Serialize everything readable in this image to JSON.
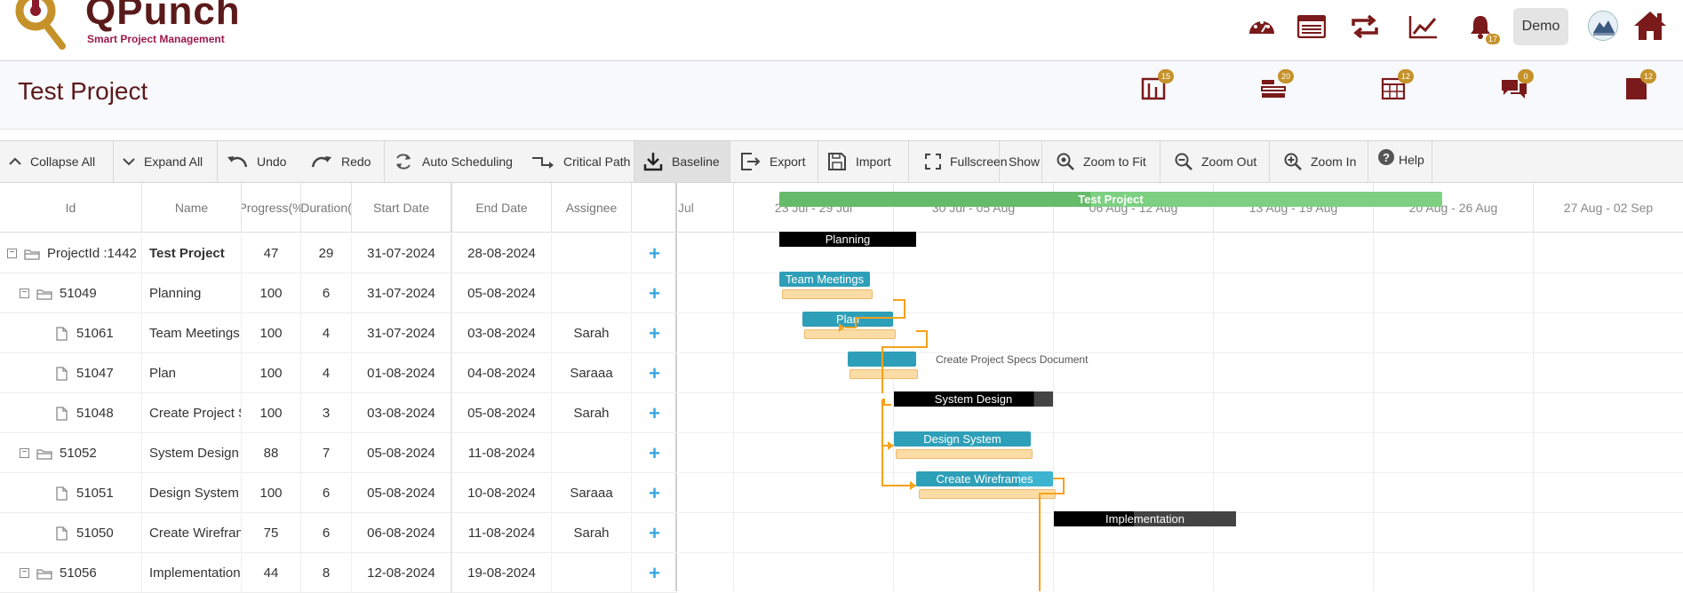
{
  "header": {
    "logo_title": "QPunch",
    "logo_sub": "Smart Project Management",
    "notifications_count": "17",
    "user_button": "Demo",
    "icons": [
      "dashboard-icon",
      "list-icon",
      "sync-icon",
      "chart-line-icon",
      "bell-icon",
      "avatar",
      "home-icon"
    ]
  },
  "project": {
    "title": "Test Project",
    "badges": [
      {
        "name": "tasks",
        "count": "15"
      },
      {
        "name": "backlog",
        "count": "20"
      },
      {
        "name": "calendar",
        "count": "12"
      },
      {
        "name": "chat",
        "count": "0"
      },
      {
        "name": "documents",
        "count": "12"
      }
    ]
  },
  "toolbar": {
    "collapse_all": "Collapse All",
    "expand_all": "Expand All",
    "undo": "Undo",
    "redo": "Redo",
    "auto_scheduling": "Auto Scheduling",
    "critical_path": "Critical Path",
    "baseline": "Baseline",
    "export": "Export",
    "import": "Import",
    "fullscreen": "Fullscreen",
    "show": "Show",
    "zoom_fit": "Zoom to Fit",
    "zoom_out": "Zoom Out",
    "zoom_in": "Zoom In",
    "help": "Help"
  },
  "grid": {
    "columns": [
      "Id",
      "Name",
      "Progress(%",
      "Duration(",
      "Start Date",
      "End Date",
      "Assignee"
    ],
    "rows": [
      {
        "id": "ProjectId :1442",
        "name": "Test Project",
        "progress": "47",
        "duration": "29",
        "start": "31-07-2024",
        "end": "28-08-2024",
        "assignee": "",
        "type": "project"
      },
      {
        "id": "51049",
        "name": "Planning",
        "progress": "100",
        "duration": "6",
        "start": "31-07-2024",
        "end": "05-08-2024",
        "assignee": "",
        "type": "group"
      },
      {
        "id": "51061",
        "name": "Team Meetings",
        "progress": "100",
        "duration": "4",
        "start": "31-07-2024",
        "end": "03-08-2024",
        "assignee": "Sarah",
        "type": "task"
      },
      {
        "id": "51047",
        "name": "Plan",
        "progress": "100",
        "duration": "4",
        "start": "01-08-2024",
        "end": "04-08-2024",
        "assignee": "Saraaa",
        "type": "task"
      },
      {
        "id": "51048",
        "name": "Create Project S",
        "progress": "100",
        "duration": "3",
        "start": "03-08-2024",
        "end": "05-08-2024",
        "assignee": "Sarah",
        "type": "task"
      },
      {
        "id": "51052",
        "name": "System Design",
        "progress": "88",
        "duration": "7",
        "start": "05-08-2024",
        "end": "11-08-2024",
        "assignee": "",
        "type": "group"
      },
      {
        "id": "51051",
        "name": "Design System",
        "progress": "100",
        "duration": "6",
        "start": "05-08-2024",
        "end": "10-08-2024",
        "assignee": "Saraaa",
        "type": "task"
      },
      {
        "id": "51050",
        "name": "Create Wirefram",
        "progress": "75",
        "duration": "6",
        "start": "06-08-2024",
        "end": "11-08-2024",
        "assignee": "Sarah",
        "type": "task"
      },
      {
        "id": "51056",
        "name": "Implementation",
        "progress": "44",
        "duration": "8",
        "start": "12-08-2024",
        "end": "19-08-2024",
        "assignee": "",
        "type": "group"
      }
    ]
  },
  "timeline": {
    "weeks": [
      "Jul",
      "23 Jul - 29 Jul",
      "30 Jul - 05 Aug",
      "06 Aug - 12 Aug",
      "13 Aug - 19 Aug",
      "20 Aug - 26 Aug",
      "27 Aug - 02 Sep"
    ],
    "bars": [
      {
        "label": "Test Project",
        "color": "#65bb6a",
        "progress": 0.47
      },
      {
        "label": "Planning",
        "color": "#000000",
        "progress": 1.0
      },
      {
        "label": "Team Meetings",
        "color": "#2e9fb8",
        "progress": 1.0
      },
      {
        "label": "Plan",
        "color": "#2e9fb8",
        "progress": 1.0
      },
      {
        "label": "",
        "color": "#2e9fb8",
        "progress": 1.0
      },
      {
        "label": "System Design",
        "color": "#000000",
        "progress": 0.88
      },
      {
        "label": "Design System",
        "color": "#2e9fb8",
        "progress": 1.0
      },
      {
        "label": "Create Wireframes",
        "color": "#2e9fb8",
        "progress": 0.75
      },
      {
        "label": "Implementation",
        "color": "#000000",
        "progress": 0.44
      }
    ],
    "external_label": "Create Project Specs Document"
  }
}
